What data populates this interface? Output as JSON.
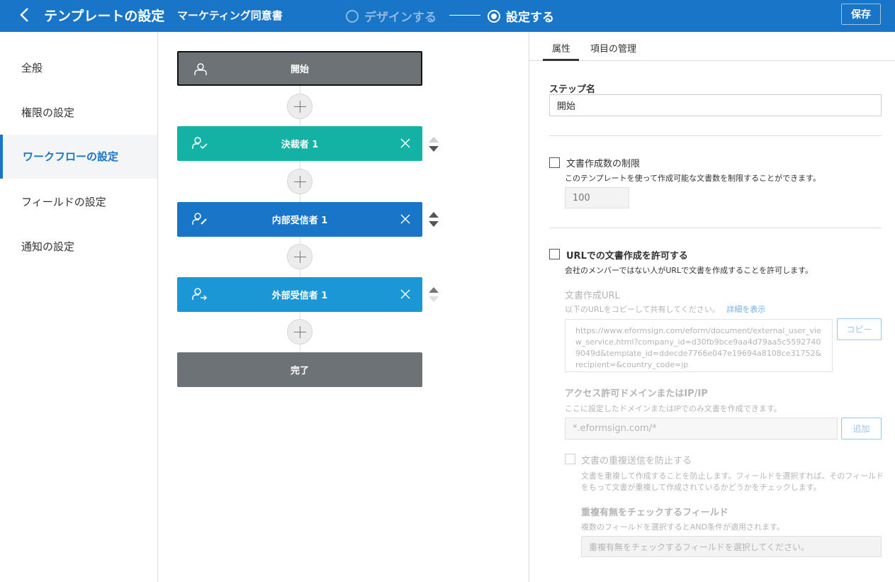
{
  "header": {
    "title": "テンプレートの設定",
    "doc_name": "マーケティング同意書",
    "step1": "デザインする",
    "step2": "設定する",
    "save": "保存"
  },
  "sidebar": {
    "items": [
      {
        "label": "全般"
      },
      {
        "label": "権限の設定"
      },
      {
        "label": "ワークフローの設定"
      },
      {
        "label": "フィールドの設定"
      },
      {
        "label": "通知の設定"
      }
    ]
  },
  "workflow": {
    "steps": [
      {
        "label": "開始"
      },
      {
        "label": "決裁者 1"
      },
      {
        "label": "内部受信者 1"
      },
      {
        "label": "外部受信者 1"
      },
      {
        "label": "完了"
      }
    ]
  },
  "panel": {
    "tabs": [
      {
        "label": "属性"
      },
      {
        "label": "項目の管理"
      }
    ],
    "step_name_label": "ステップ名",
    "step_name_value": "開始",
    "limit": {
      "label": "文書作成数の制限",
      "hint": "このテンプレートを使って作成可能な文書数を制限することができます。",
      "value": "100"
    },
    "url": {
      "label": "URLでの文書作成を許可する",
      "hint": "会社のメンバーではない人がURLで文書を作成することを許可します。",
      "create_url_label": "文書作成URL",
      "copy_hint": "以下のURLをコピーして共有してください。",
      "detail_link": "詳細を表示",
      "url_value": "https://www.eformsign.com/eform/document/external_user_view_service.html?company_id=d30fb9bce9aa4d79aa5c55927409049d&template_id=ddecde7766e047e19694a8108ce31752&recipient=&country_code=jp",
      "copy_button": "コピー",
      "domain_label": "アクセス許可ドメインまたはIP/IP",
      "domain_hint": "ここに設定したドメインまたはIPでのみ文書を作成できます。",
      "domain_placeholder": "*.eformsign.com/*",
      "add_button": "追加",
      "dup_label": "文書の重複送信を防止する",
      "dup_hint1": "文書を重複して作成することを防止します。フィールドを選択すれば、そのフィールド",
      "dup_hint2": "をもって文書が重複して作成されているかどうかをチェックします。",
      "field_label": "重複有無をチェックするフィールド",
      "field_hint": "複数のフィールドを選択するとAND条件が適用されます。",
      "field_placeholder": "重複有無をチェックするフィールドを選択してください。"
    }
  }
}
